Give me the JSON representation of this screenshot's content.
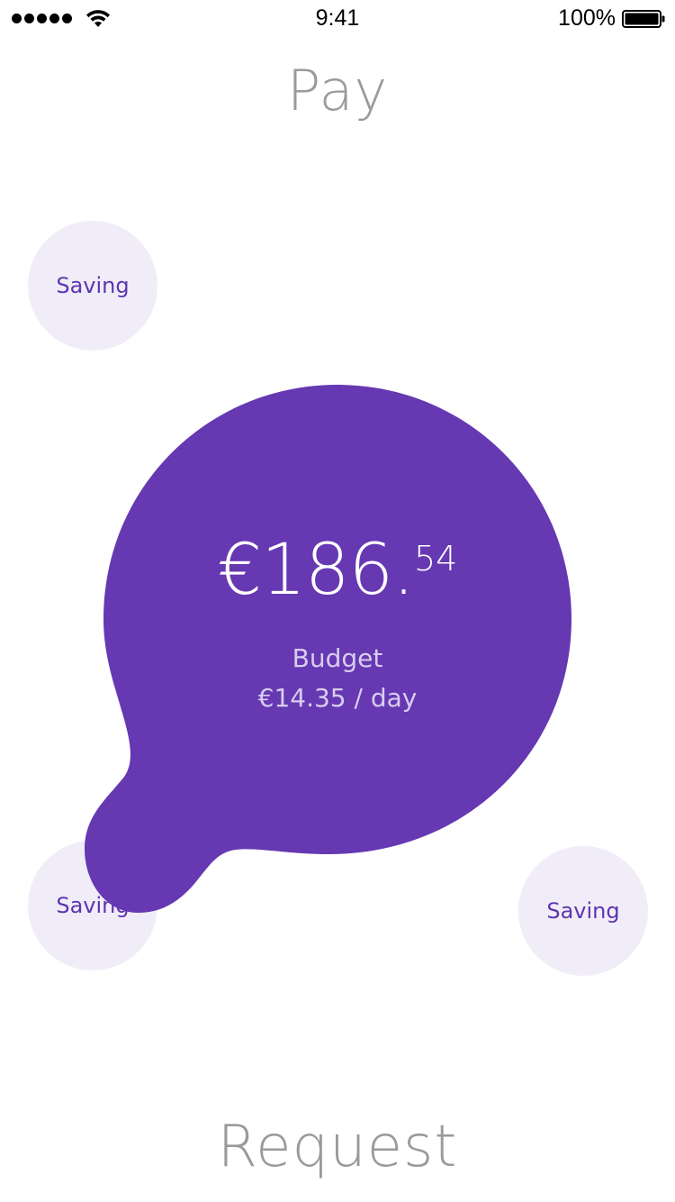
{
  "status_bar": {
    "time": "9:41",
    "battery_percent": "100%",
    "signal_icon": "signal-dots-icon",
    "wifi_icon": "wifi-icon",
    "battery_icon": "battery-icon"
  },
  "header": {
    "title": "Pay"
  },
  "savings": [
    {
      "label": "Saving"
    },
    {
      "label": "Saving"
    },
    {
      "label": "Saving"
    }
  ],
  "balance": {
    "amount_main": "€186.",
    "amount_cents": "54",
    "budget_label": "Budget",
    "budget_rate": "€14.35 / day"
  },
  "footer": {
    "title": "Request"
  },
  "colors": {
    "accent": "#6639b3",
    "saving_bg": "#f1edf8",
    "saving_text": "#5e35b1",
    "title_gray": "#9a9a9a"
  }
}
